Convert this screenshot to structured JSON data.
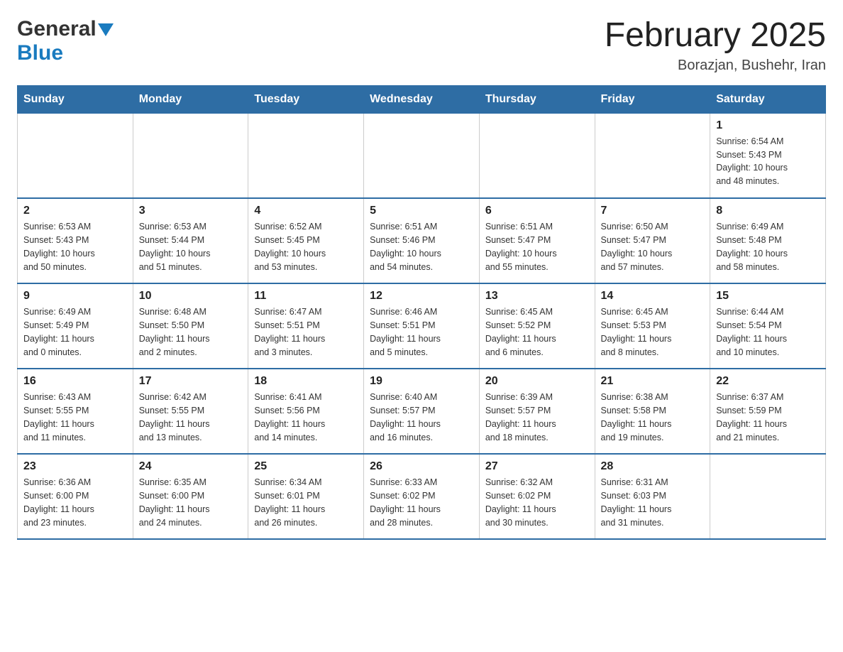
{
  "header": {
    "logo_general": "General",
    "logo_blue": "Blue",
    "title": "February 2025",
    "subtitle": "Borazjan, Bushehr, Iran"
  },
  "days_of_week": [
    "Sunday",
    "Monday",
    "Tuesday",
    "Wednesday",
    "Thursday",
    "Friday",
    "Saturday"
  ],
  "weeks": [
    {
      "days": [
        {
          "number": "",
          "info": ""
        },
        {
          "number": "",
          "info": ""
        },
        {
          "number": "",
          "info": ""
        },
        {
          "number": "",
          "info": ""
        },
        {
          "number": "",
          "info": ""
        },
        {
          "number": "",
          "info": ""
        },
        {
          "number": "1",
          "info": "Sunrise: 6:54 AM\nSunset: 5:43 PM\nDaylight: 10 hours\nand 48 minutes."
        }
      ]
    },
    {
      "days": [
        {
          "number": "2",
          "info": "Sunrise: 6:53 AM\nSunset: 5:43 PM\nDaylight: 10 hours\nand 50 minutes."
        },
        {
          "number": "3",
          "info": "Sunrise: 6:53 AM\nSunset: 5:44 PM\nDaylight: 10 hours\nand 51 minutes."
        },
        {
          "number": "4",
          "info": "Sunrise: 6:52 AM\nSunset: 5:45 PM\nDaylight: 10 hours\nand 53 minutes."
        },
        {
          "number": "5",
          "info": "Sunrise: 6:51 AM\nSunset: 5:46 PM\nDaylight: 10 hours\nand 54 minutes."
        },
        {
          "number": "6",
          "info": "Sunrise: 6:51 AM\nSunset: 5:47 PM\nDaylight: 10 hours\nand 55 minutes."
        },
        {
          "number": "7",
          "info": "Sunrise: 6:50 AM\nSunset: 5:47 PM\nDaylight: 10 hours\nand 57 minutes."
        },
        {
          "number": "8",
          "info": "Sunrise: 6:49 AM\nSunset: 5:48 PM\nDaylight: 10 hours\nand 58 minutes."
        }
      ]
    },
    {
      "days": [
        {
          "number": "9",
          "info": "Sunrise: 6:49 AM\nSunset: 5:49 PM\nDaylight: 11 hours\nand 0 minutes."
        },
        {
          "number": "10",
          "info": "Sunrise: 6:48 AM\nSunset: 5:50 PM\nDaylight: 11 hours\nand 2 minutes."
        },
        {
          "number": "11",
          "info": "Sunrise: 6:47 AM\nSunset: 5:51 PM\nDaylight: 11 hours\nand 3 minutes."
        },
        {
          "number": "12",
          "info": "Sunrise: 6:46 AM\nSunset: 5:51 PM\nDaylight: 11 hours\nand 5 minutes."
        },
        {
          "number": "13",
          "info": "Sunrise: 6:45 AM\nSunset: 5:52 PM\nDaylight: 11 hours\nand 6 minutes."
        },
        {
          "number": "14",
          "info": "Sunrise: 6:45 AM\nSunset: 5:53 PM\nDaylight: 11 hours\nand 8 minutes."
        },
        {
          "number": "15",
          "info": "Sunrise: 6:44 AM\nSunset: 5:54 PM\nDaylight: 11 hours\nand 10 minutes."
        }
      ]
    },
    {
      "days": [
        {
          "number": "16",
          "info": "Sunrise: 6:43 AM\nSunset: 5:55 PM\nDaylight: 11 hours\nand 11 minutes."
        },
        {
          "number": "17",
          "info": "Sunrise: 6:42 AM\nSunset: 5:55 PM\nDaylight: 11 hours\nand 13 minutes."
        },
        {
          "number": "18",
          "info": "Sunrise: 6:41 AM\nSunset: 5:56 PM\nDaylight: 11 hours\nand 14 minutes."
        },
        {
          "number": "19",
          "info": "Sunrise: 6:40 AM\nSunset: 5:57 PM\nDaylight: 11 hours\nand 16 minutes."
        },
        {
          "number": "20",
          "info": "Sunrise: 6:39 AM\nSunset: 5:57 PM\nDaylight: 11 hours\nand 18 minutes."
        },
        {
          "number": "21",
          "info": "Sunrise: 6:38 AM\nSunset: 5:58 PM\nDaylight: 11 hours\nand 19 minutes."
        },
        {
          "number": "22",
          "info": "Sunrise: 6:37 AM\nSunset: 5:59 PM\nDaylight: 11 hours\nand 21 minutes."
        }
      ]
    },
    {
      "days": [
        {
          "number": "23",
          "info": "Sunrise: 6:36 AM\nSunset: 6:00 PM\nDaylight: 11 hours\nand 23 minutes."
        },
        {
          "number": "24",
          "info": "Sunrise: 6:35 AM\nSunset: 6:00 PM\nDaylight: 11 hours\nand 24 minutes."
        },
        {
          "number": "25",
          "info": "Sunrise: 6:34 AM\nSunset: 6:01 PM\nDaylight: 11 hours\nand 26 minutes."
        },
        {
          "number": "26",
          "info": "Sunrise: 6:33 AM\nSunset: 6:02 PM\nDaylight: 11 hours\nand 28 minutes."
        },
        {
          "number": "27",
          "info": "Sunrise: 6:32 AM\nSunset: 6:02 PM\nDaylight: 11 hours\nand 30 minutes."
        },
        {
          "number": "28",
          "info": "Sunrise: 6:31 AM\nSunset: 6:03 PM\nDaylight: 11 hours\nand 31 minutes."
        },
        {
          "number": "",
          "info": ""
        }
      ]
    }
  ]
}
